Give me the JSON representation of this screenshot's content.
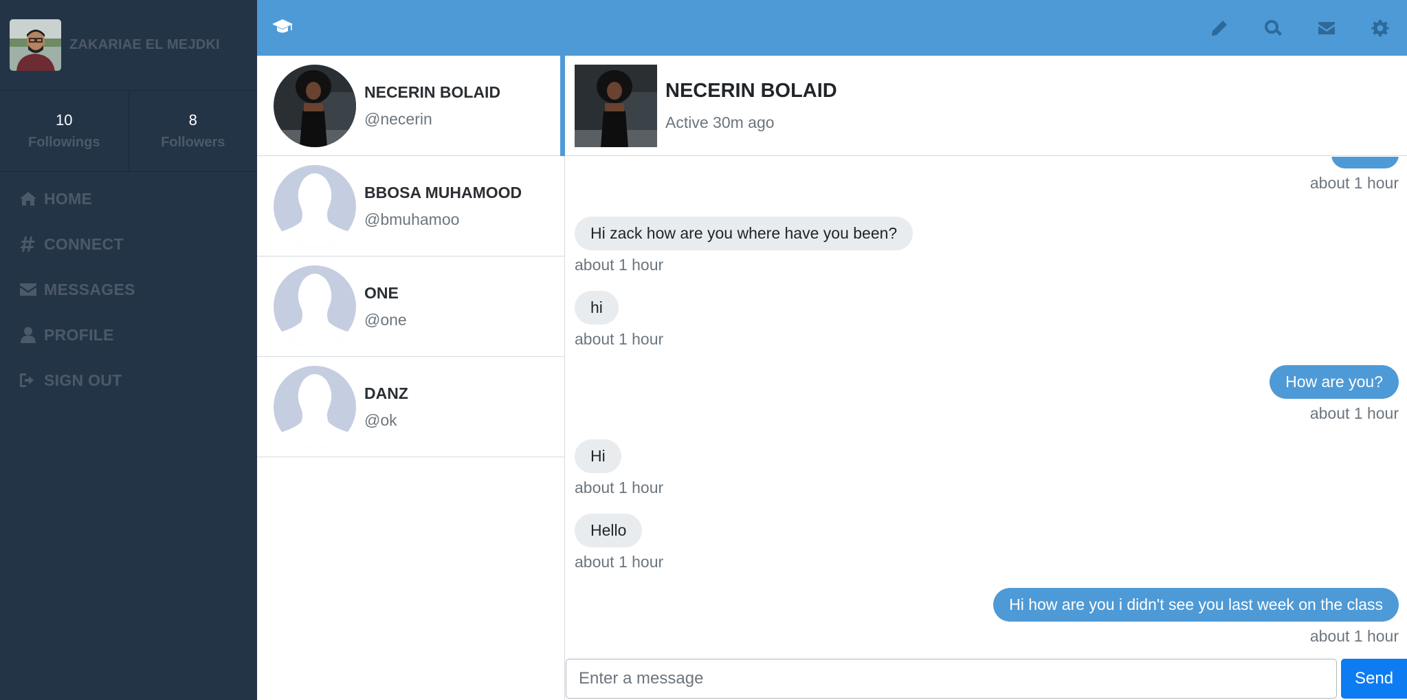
{
  "sidebar": {
    "profile_name": "ZAKARIAE EL MEJDKI",
    "followings_count": "10",
    "followings_label": "Followings",
    "followers_count": "8",
    "followers_label": "Followers",
    "nav": [
      {
        "label": "HOME",
        "icon": "home-icon"
      },
      {
        "label": "CONNECT",
        "icon": "hashtag-icon"
      },
      {
        "label": "MESSAGES",
        "icon": "envelope-icon"
      },
      {
        "label": "PROFILE",
        "icon": "user-icon"
      },
      {
        "label": "SIGN OUT",
        "icon": "sign-out-icon"
      }
    ]
  },
  "topbar": {
    "brand_icon": "graduation-cap-icon",
    "icons": [
      "pencil-icon",
      "search-icon",
      "envelope-icon",
      "gear-icon"
    ]
  },
  "contacts": [
    {
      "name": "NECERIN BOLAID",
      "handle": "@necerin",
      "active": true
    },
    {
      "name": "BBOSA MUHAMOOD",
      "handle": "@bmuhamoo"
    },
    {
      "name": "ONE",
      "handle": "@one"
    },
    {
      "name": "DANZ",
      "handle": "@ok"
    }
  ],
  "chat": {
    "name": "NECERIN BOLAID",
    "status": "Active 30m ago",
    "messages": [
      {
        "text": "",
        "time": "about 1 hour",
        "direction": "out"
      },
      {
        "text": "Hi zack how are you where have you been?",
        "time": "about 1 hour",
        "direction": "in"
      },
      {
        "text": "hi",
        "time": "about 1 hour",
        "direction": "in"
      },
      {
        "text": "How are you?",
        "time": "about 1 hour",
        "direction": "out"
      },
      {
        "text": "Hi",
        "time": "about 1 hour",
        "direction": "in"
      },
      {
        "text": "Hello",
        "time": "about 1 hour",
        "direction": "in"
      },
      {
        "text": "Hi how are you i didn't see you last week on the class",
        "time": "about 1 hour",
        "direction": "out"
      }
    ],
    "input_placeholder": "Enter a message",
    "send_label": "Send"
  },
  "colors": {
    "sidebar_bg": "#243447",
    "topbar_bg": "#4e9ad6",
    "accent": "#4e9ad6",
    "send_button": "#0d7cf2",
    "muted_text": "#4c5968"
  }
}
